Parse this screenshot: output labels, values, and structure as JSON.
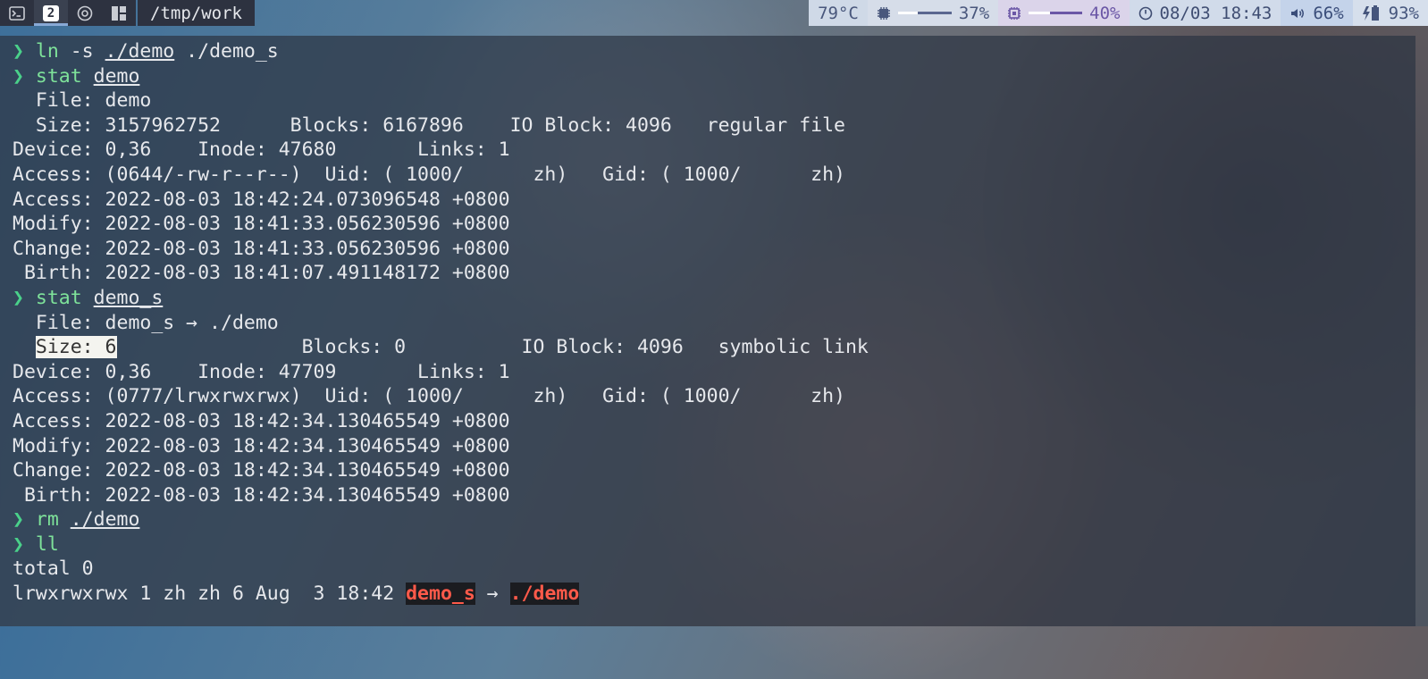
{
  "topbar": {
    "workspaces": [
      {
        "icon": "terminal-icon",
        "label": ""
      },
      {
        "icon": "number-2-icon",
        "label": "2"
      },
      {
        "icon": "browser-icon",
        "label": ""
      },
      {
        "icon": "windows-icon",
        "label": ""
      }
    ],
    "path": "/tmp/work",
    "temperature": "79°C",
    "memory": {
      "value": "37%",
      "level": 0.37
    },
    "cpu": {
      "value": "40%",
      "level": 0.4
    },
    "datetime": "08/03 18:43",
    "volume": "66%",
    "battery": "93%"
  },
  "terminal": {
    "lines": [
      {
        "type": "cmd",
        "cmd": "ln",
        "args": [
          {
            "t": " -s "
          },
          {
            "t": "./demo",
            "u": true
          },
          {
            "t": " ./demo_s"
          }
        ]
      },
      {
        "type": "cmd",
        "cmd": "stat",
        "args": [
          {
            "t": " "
          },
          {
            "t": "demo",
            "u": true
          }
        ]
      },
      {
        "type": "out",
        "text": "  File: demo"
      },
      {
        "type": "out",
        "text": "  Size: 3157962752      Blocks: 6167896    IO Block: 4096   regular file"
      },
      {
        "type": "out",
        "text": "Device: 0,36    Inode: 47680       Links: 1"
      },
      {
        "type": "out",
        "text": "Access: (0644/-rw-r--r--)  Uid: ( 1000/      zh)   Gid: ( 1000/      zh)"
      },
      {
        "type": "out",
        "text": "Access: 2022-08-03 18:42:24.073096548 +0800"
      },
      {
        "type": "out",
        "text": "Modify: 2022-08-03 18:41:33.056230596 +0800"
      },
      {
        "type": "out",
        "text": "Change: 2022-08-03 18:41:33.056230596 +0800"
      },
      {
        "type": "out",
        "text": " Birth: 2022-08-03 18:41:07.491148172 +0800"
      },
      {
        "type": "cmd",
        "cmd": "stat",
        "args": [
          {
            "t": " "
          },
          {
            "t": "demo_s",
            "u": true
          }
        ]
      },
      {
        "type": "out",
        "text": "  File: demo_s → ./demo"
      },
      {
        "type": "hlline",
        "hl": "Size: 6",
        "pre": "  ",
        "rest": "                Blocks: 0          IO Block: 4096   symbolic link"
      },
      {
        "type": "out",
        "text": "Device: 0,36    Inode: 47709       Links: 1"
      },
      {
        "type": "out",
        "text": "Access: (0777/lrwxrwxrwx)  Uid: ( 1000/      zh)   Gid: ( 1000/      zh)"
      },
      {
        "type": "out",
        "text": "Access: 2022-08-03 18:42:34.130465549 +0800"
      },
      {
        "type": "out",
        "text": "Modify: 2022-08-03 18:42:34.130465549 +0800"
      },
      {
        "type": "out",
        "text": "Change: 2022-08-03 18:42:34.130465549 +0800"
      },
      {
        "type": "out",
        "text": " Birth: 2022-08-03 18:42:34.130465549 +0800"
      },
      {
        "type": "cmd",
        "cmd": "rm",
        "args": [
          {
            "t": " "
          },
          {
            "t": "./demo",
            "u": true
          }
        ]
      },
      {
        "type": "cmd",
        "cmd": "ll",
        "args": []
      },
      {
        "type": "out",
        "text": "total 0"
      },
      {
        "type": "lsline",
        "text": "lrwxrwxrwx 1 zh zh 6 Aug  3 18:42 ",
        "name": "demo_s",
        "arrow": " → ",
        "target": "./demo"
      }
    ],
    "prompt_symbol": "❯"
  },
  "colors": {
    "prompt": "#4ad18a",
    "command": "#7ee29a",
    "broken_link": "#ff5a4a"
  }
}
